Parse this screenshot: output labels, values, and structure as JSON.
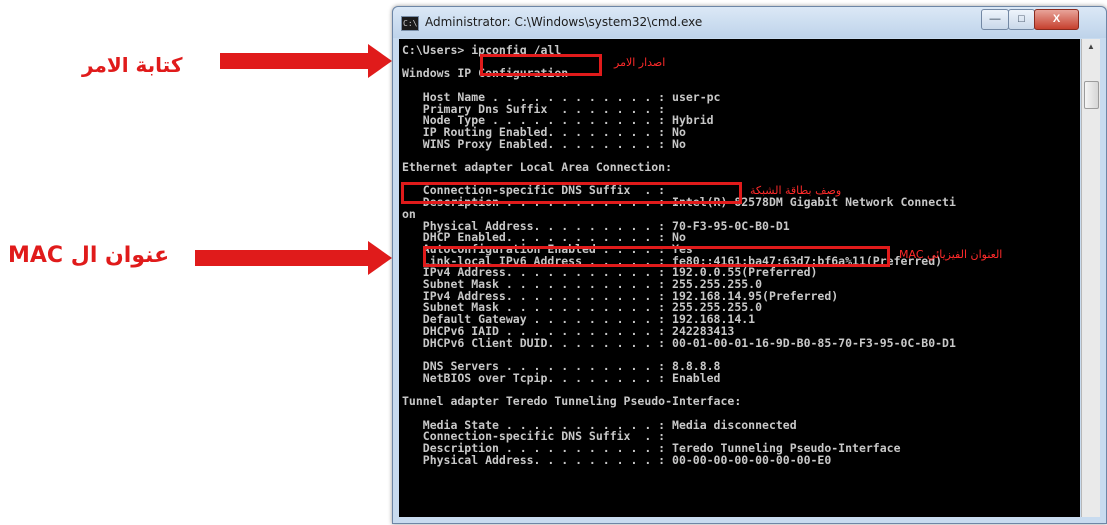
{
  "callouts": {
    "type_command": "كتابة الامر",
    "mac_address": "عنوان ال MAC"
  },
  "window": {
    "icon_label": "C:\\",
    "title": "Administrator: C:\\Windows\\system32\\cmd.exe",
    "minimize_glyph": "—",
    "maximize_glyph": "□",
    "close_glyph": "X"
  },
  "console": {
    "lines": [
      "C:\\Users> ipconfig /all",
      "",
      "Windows IP Configuration",
      "",
      "   Host Name . . . . . . . . . . . . : user-pc",
      "   Primary Dns Suffix  . . . . . . . :",
      "   Node Type . . . . . . . . . . . . : Hybrid",
      "   IP Routing Enabled. . . . . . . . : No",
      "   WINS Proxy Enabled. . . . . . . . : No",
      "",
      "Ethernet adapter Local Area Connection:",
      "",
      "   Connection-specific DNS Suffix  . :",
      "   Description . . . . . . . . . . . : Intel(R) 82578DM Gigabit Network Connecti",
      "on",
      "   Physical Address. . . . . . . . . : 70-F3-95-0C-B0-D1",
      "   DHCP Enabled. . . . . . . . . . . : No",
      "   Autoconfiguration Enabled . . . . : Yes",
      "   Link-local IPv6 Address . . . . . : fe80::4161:ba47:63d7:bf6a%11(Preferred)",
      "   IPv4 Address. . . . . . . . . . . : 192.0.0.55(Preferred)",
      "   Subnet Mask . . . . . . . . . . . : 255.255.255.0",
      "   IPv4 Address. . . . . . . . . . . : 192.168.14.95(Preferred)",
      "   Subnet Mask . . . . . . . . . . . : 255.255.255.0",
      "   Default Gateway . . . . . . . . . : 192.168.14.1",
      "   DHCPv6 IAID . . . . . . . . . . . : 242283413",
      "   DHCPv6 Client DUID. . . . . . . . : 00-01-00-01-16-9D-B0-85-70-F3-95-0C-B0-D1",
      "",
      "   DNS Servers . . . . . . . . . . . : 8.8.8.8",
      "   NetBIOS over Tcpip. . . . . . . . : Enabled",
      "",
      "Tunnel adapter Teredo Tunneling Pseudo-Interface:",
      "",
      "   Media State . . . . . . . . . . . : Media disconnected",
      "   Connection-specific DNS Suffix  . :",
      "   Description . . . . . . . . . . . : Teredo Tunneling Pseudo-Interface",
      "   Physical Address. . . . . . . . . : 00-00-00-00-00-00-00-E0"
    ]
  },
  "annotations": {
    "issue_command": "اصدار الامر",
    "adapter_description": "وصف بطاقة الشبكة",
    "physical_address": "العنوان الفيزيائي MAC"
  },
  "colors": {
    "annotation_red": "#e01b1b",
    "console_bg": "#000000",
    "console_text": "#c8c8c8"
  }
}
